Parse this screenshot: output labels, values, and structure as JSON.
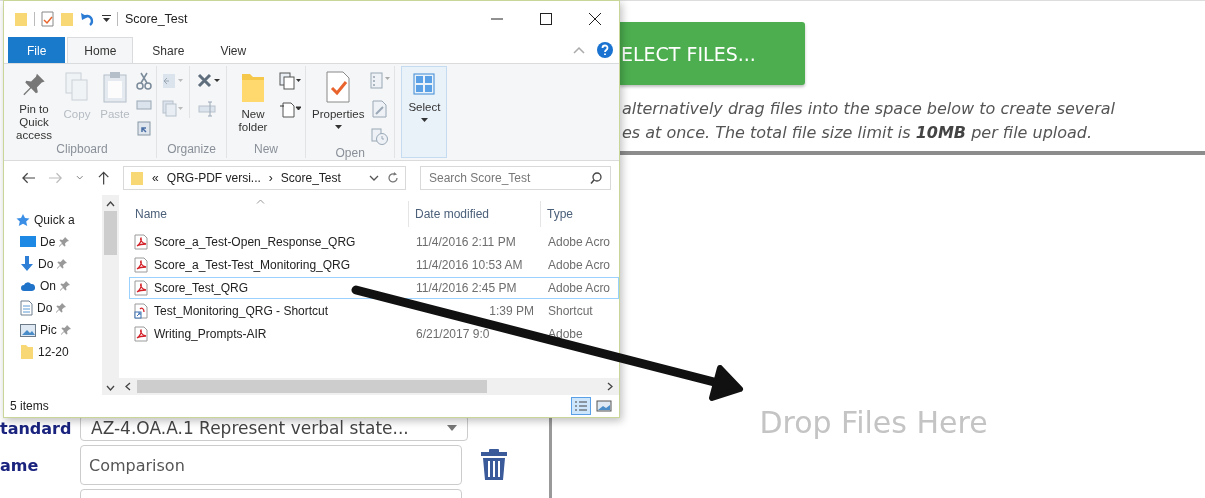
{
  "page": {
    "upload_button": "ELECT FILES...",
    "hint_lines": [
      "alternatively drag files into the space below to create several",
      "es at once. The total file size limit is **10MB** per file upload."
    ],
    "drop_zone": "Drop Files Here",
    "form": [
      {
        "label": "tandard",
        "kind": "select",
        "value": "AZ-4.OA.A.1 Represent verbal state..."
      },
      {
        "label": "ame",
        "kind": "input",
        "value": "Comparison",
        "deletable": true
      },
      {
        "kind": "input"
      }
    ]
  },
  "explorer": {
    "title": "Score_Test",
    "tabs": [
      {
        "label": "File",
        "kind": "file",
        "selected": false
      },
      {
        "label": "Home",
        "kind": "tab",
        "selected": true
      },
      {
        "label": "Share",
        "kind": "tab",
        "selected": false
      },
      {
        "label": "View",
        "kind": "tab",
        "selected": false
      }
    ],
    "ribbon_groups": [
      {
        "kind": "clipboard",
        "label": "Clipboard",
        "commands": [
          {
            "kind": "pin",
            "label": "Pin to Quick access",
            "disabled": false
          },
          {
            "kind": "copy",
            "label": "Copy",
            "disabled": true
          },
          {
            "kind": "paste",
            "label": "Paste",
            "disabled": true
          }
        ]
      },
      {
        "kind": "organize",
        "label": "Organize"
      },
      {
        "kind": "new",
        "label": "New",
        "commands": [
          {
            "kind": "new-folder",
            "label": "New folder",
            "disabled": false
          }
        ]
      },
      {
        "kind": "open",
        "label": "Open",
        "commands": [
          {
            "kind": "properties",
            "label": "Properties",
            "disabled": false
          }
        ]
      },
      {
        "kind": "select",
        "commands": [
          {
            "kind": "select",
            "label": "Select",
            "disabled": false
          }
        ]
      }
    ],
    "address_path": [
      "«",
      "QRG-PDF versi...",
      "›",
      "Score_Test"
    ],
    "search_placeholder": "Search Score_Test",
    "nav_items": [
      {
        "kind": "star",
        "label": "Quick a",
        "pinned": false
      },
      {
        "kind": "desktop",
        "label": "De",
        "pinned": true
      },
      {
        "kind": "download",
        "label": "Do",
        "pinned": true
      },
      {
        "kind": "cloud",
        "label": "On",
        "pinned": true
      },
      {
        "kind": "document",
        "label": "Do",
        "pinned": true
      },
      {
        "kind": "pictures",
        "label": "Pic",
        "pinned": true
      },
      {
        "kind": "folder",
        "label": "12-20",
        "pinned": false
      }
    ],
    "columns": [
      "Name",
      "Date modified",
      "Type"
    ],
    "files": [
      {
        "kind": "pdf",
        "name": "Score_a_Test-Open_Response_QRG",
        "date": "11/4/2016 2:11 PM",
        "type": "Adobe Acro",
        "selected": false
      },
      {
        "kind": "pdf",
        "name": "Score_a_Test-Test_Monitoring_QRG",
        "date": "11/4/2016 10:53 AM",
        "type": "Adobe Acro",
        "selected": false
      },
      {
        "kind": "pdf",
        "name": "Score_Test_QRG",
        "date": "11/4/2016 2:45 PM",
        "type": "Adobe Acro",
        "selected": true
      },
      {
        "kind": "shortcut",
        "name": "Test_Monitoring_QRG - Shortcut",
        "date": "1:39 PM",
        "type": "Shortcut",
        "selected": false
      },
      {
        "kind": "pdf",
        "name": "Writing_Prompts-AIR",
        "date": "6/21/2017 9:0",
        "type": "Adobe",
        "selected": false
      }
    ],
    "status": "5 items"
  }
}
